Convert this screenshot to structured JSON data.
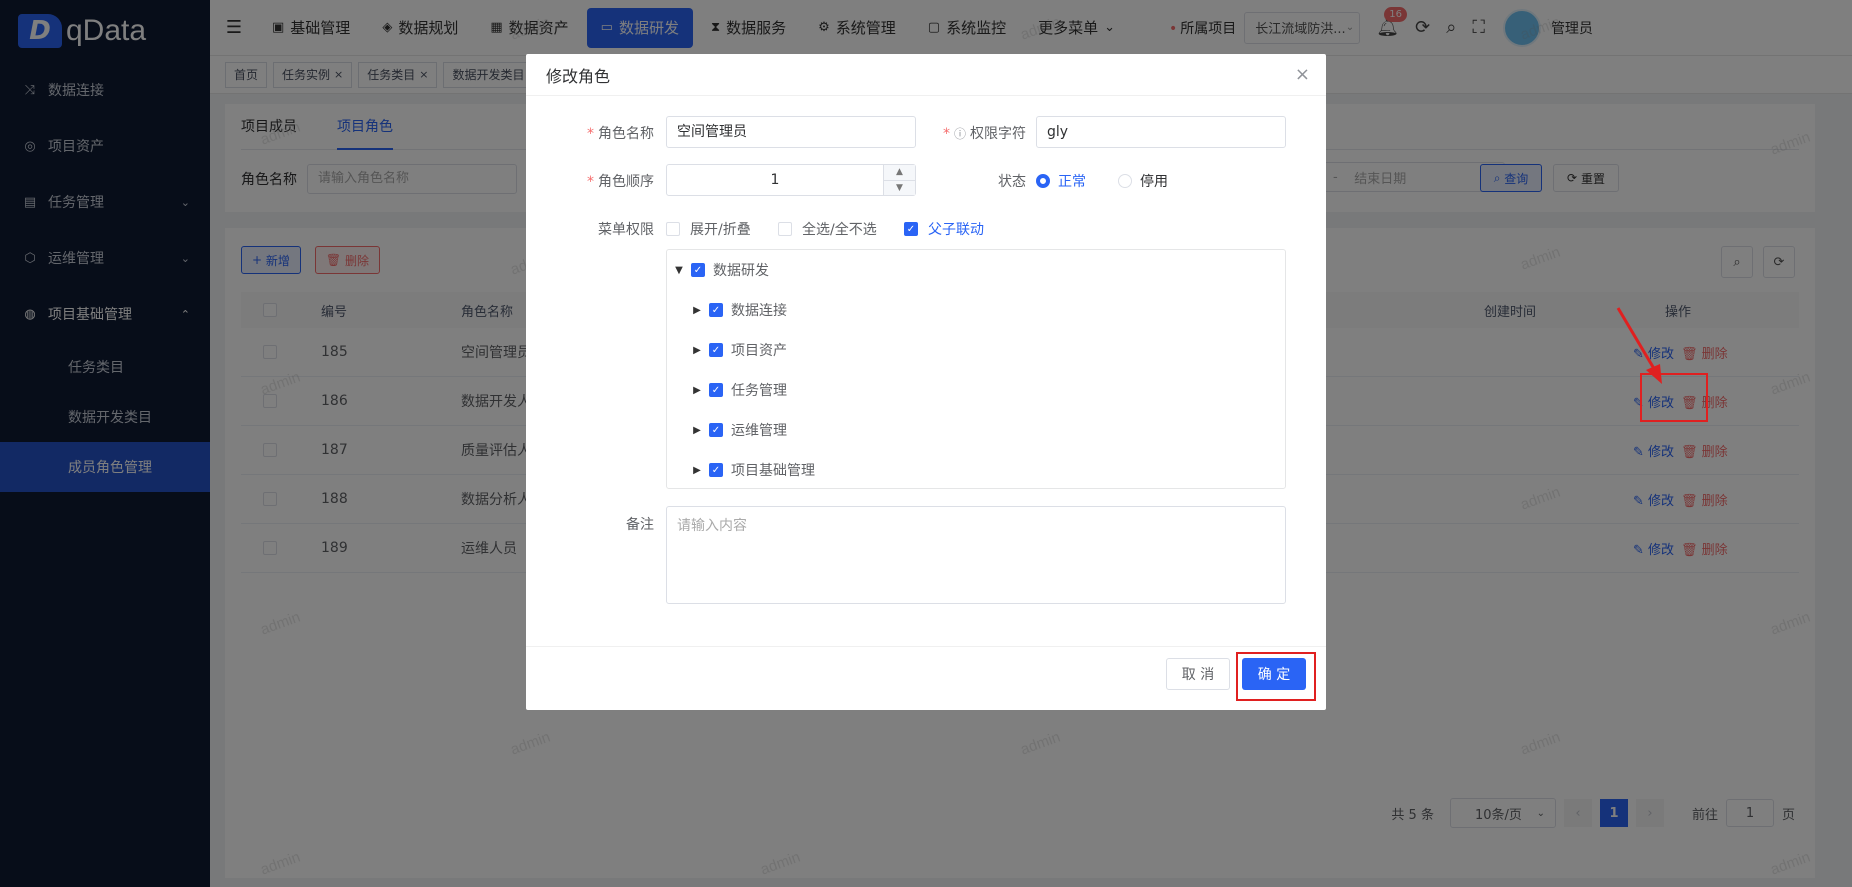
{
  "logo": {
    "mark": "D",
    "name": "qData"
  },
  "sidebar": {
    "items": [
      {
        "label": "数据连接",
        "icon": "shuffle-icon"
      },
      {
        "label": "项目资产",
        "icon": "asset-icon"
      },
      {
        "label": "任务管理",
        "icon": "task-icon",
        "has_caret": true
      },
      {
        "label": "运维管理",
        "icon": "cube-icon",
        "has_caret": true
      },
      {
        "label": "项目基础管理",
        "icon": "globe-icon",
        "expanded": true
      }
    ],
    "sub_items": [
      {
        "label": "任务类目"
      },
      {
        "label": "数据开发类目"
      },
      {
        "label": "成员角色管理",
        "active": true
      }
    ]
  },
  "topnav": {
    "items": [
      {
        "label": "基础管理"
      },
      {
        "label": "数据规划"
      },
      {
        "label": "数据资产"
      },
      {
        "label": "数据研发",
        "active": true
      },
      {
        "label": "数据服务"
      },
      {
        "label": "系统管理"
      },
      {
        "label": "系统监控"
      },
      {
        "label": "更多菜单"
      }
    ],
    "project_label": "所属项目",
    "project_value": "长江流域防洪...",
    "notification_count": "16",
    "user_name": "管理员"
  },
  "tags": [
    {
      "label": "首页",
      "closable": false
    },
    {
      "label": "任务实例",
      "closable": true
    },
    {
      "label": "任务类目",
      "closable": true
    },
    {
      "label": "数据开发类目",
      "closable": false
    }
  ],
  "main": {
    "tabs": [
      {
        "label": "项目成员"
      },
      {
        "label": "项目角色",
        "active": true
      }
    ],
    "search_label": "角色名称",
    "search_placeholder": "请输入角色名称",
    "date_sep": "-",
    "date_end": "结束日期",
    "query_label": "查询",
    "reset_label": "重置",
    "add_label": "新增",
    "delete_label": "删除",
    "columns": {
      "id": "编号",
      "name": "角色名称",
      "time": "创建时间",
      "op": "操作"
    },
    "rows": [
      {
        "id": "185",
        "name": "空间管理员"
      },
      {
        "id": "186",
        "name": "数据开发人员"
      },
      {
        "id": "187",
        "name": "质量评估人员"
      },
      {
        "id": "188",
        "name": "数据分析人员"
      },
      {
        "id": "189",
        "name": "运维人员"
      }
    ],
    "edit_label": "修改",
    "del_label": "删除",
    "pagination": {
      "total": "共 5 条",
      "page_size": "10条/页",
      "current": "1",
      "goto_label": "前往",
      "goto_value": "1",
      "page_suffix": "页"
    }
  },
  "modal": {
    "title": "修改角色",
    "role_name_label": "角色名称",
    "role_name_value": "空间管理员",
    "perm_label": "权限字符",
    "perm_value": "gly",
    "order_label": "角色顺序",
    "order_value": "1",
    "status_label": "状态",
    "status_normal": "正常",
    "status_disabled": "停用",
    "menu_perm_label": "菜单权限",
    "expand_label": "展开/折叠",
    "select_all_label": "全选/全不选",
    "linkage_label": "父子联动",
    "tree": {
      "root": "数据研发",
      "children": [
        "数据连接",
        "项目资产",
        "任务管理",
        "运维管理",
        "项目基础管理"
      ]
    },
    "remark_label": "备注",
    "remark_placeholder": "请输入内容",
    "cancel_label": "取 消",
    "ok_label": "确 定"
  },
  "watermark_text": "admin",
  "colors": {
    "primary": "#2a64f5",
    "danger": "#f56c6c",
    "sidebar": "#0f1a33",
    "highlight": "#e02020"
  }
}
